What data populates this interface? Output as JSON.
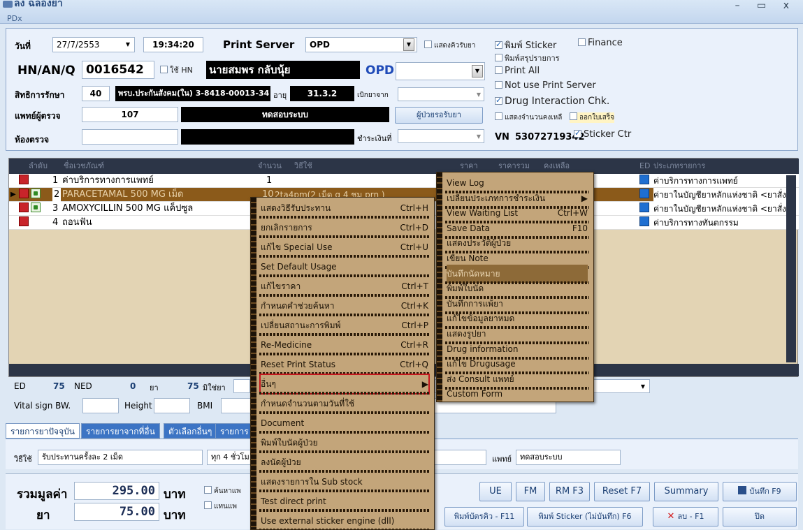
{
  "window": {
    "title": "ลง ฉลองยา",
    "subtitle": "PDx",
    "controls": "– ▭ x"
  },
  "header": {
    "date_label": "วันที่",
    "date_value": "27/7/2553",
    "time_value": "19:34:20",
    "print_server_label": "Print Server",
    "print_server_value": "OPD",
    "show_queue_label": "แสดงคิวรับยา",
    "print_sticker_label": "พิมพ์ Sticker",
    "finance_label": "Finance",
    "print_summary_label": "พิมพ์สรุปรายการ",
    "print_all_label": "Print All",
    "not_use_print_server_label": "Not use Print Server",
    "drug_interaction_label": "Drug Interaction Chk.",
    "show_remaining_label": "แสดงจำนวนคงเหลื",
    "issue_receipt_label": "ออกใบเสร็จ",
    "sticker_ctr_label": "Sticker Ctr",
    "hn_label": "HN/AN/Q",
    "hn_value": "0016542",
    "use_hn_label": "ใช้ HN",
    "patient_name": "นายสมพร  กลับนุ้ย",
    "dept_value": "OPD",
    "rights_label": "สิทธิการรักษา",
    "rights_code": "40",
    "rights_name": "พรบ.ประกันสังคม(ใน) 3-8418-00013-34",
    "age_label": "อายุ",
    "age_value": "31.3.2",
    "reimburse_label": "เบิกยาจาก",
    "doctor_label": "แพทย์ผู้ตรวจ",
    "doctor_code": "107",
    "doctor_name": "ทดสอบระบบ",
    "waiting_patients_button": "ผู้ป่วยรอรับยา",
    "room_label": "ห้องตรวจ",
    "payment_label": "ชำระเงินที่",
    "vn_label": "VN",
    "vn_value": "53072719342"
  },
  "grid": {
    "headers": [
      "ลำดับ",
      "ชื่อเวชภัณฑ์",
      "จำนวน",
      "วิธีใช้",
      "ราคา",
      "ราคารวม",
      "คงเหลือ",
      "ED",
      "ประเภทรายการ"
    ],
    "rows": [
      {
        "no": "1",
        "name": "ค่าบริการทางการแพทย์",
        "qty": "1",
        "usage": "",
        "category": "ค่าบริการทางการแพทย์"
      },
      {
        "no": "2",
        "name": "PARACETAMAL 500 MG เม็ด",
        "qty": "10",
        "usage": "2ta4pm(2 เม็ด q 4 ชม prn )",
        "category": "ค่ายาในบัญชียาหลักแห่งชาติ <ยาสั่งใ"
      },
      {
        "no": "3",
        "name": "AMOXYCILLIN 500 MG แค็ปซูล",
        "qty": "",
        "usage": "",
        "category": "ค่ายาในบัญชียาหลักแห่งชาติ <ยาสั่งใ"
      },
      {
        "no": "4",
        "name": "ถอนฟัน",
        "qty": "",
        "usage": "",
        "category": "ค่าบริการทางทันตกรรม"
      }
    ]
  },
  "context_menu": {
    "items": [
      {
        "label": "แสดงวิธีรับประทาน",
        "shortcut": "Ctrl+H"
      },
      {
        "label": "ยกเลิกรายการ",
        "shortcut": "Ctrl+D"
      },
      {
        "label": "แก้ไข Special Use",
        "shortcut": "Ctrl+U"
      },
      {
        "label": "Set Default Usage",
        "shortcut": ""
      },
      {
        "label": "แก้ไขราคา",
        "shortcut": "Ctrl+T"
      },
      {
        "label": "กำหนดคำช่วยค้นหา",
        "shortcut": "Ctrl+K"
      },
      {
        "label": "เปลี่ยนสถานะการพิมพ์",
        "shortcut": "Ctrl+P"
      },
      {
        "label": "Re-Medicine",
        "shortcut": "Ctrl+R"
      },
      {
        "label": "Reset Print Status",
        "shortcut": "Ctrl+Q"
      },
      {
        "label": "อื่นๆ",
        "shortcut": "▶"
      },
      {
        "label": "กำหนดจำนวนตามวันที่ใช้",
        "shortcut": ""
      },
      {
        "label": "Document",
        "shortcut": ""
      },
      {
        "label": "พิมพ์ใบนัดผู้ป่วย",
        "shortcut": ""
      },
      {
        "label": "ลงนัดผู้ป่วย",
        "shortcut": ""
      },
      {
        "label": "แสดงรายการใน Sub stock",
        "shortcut": ""
      },
      {
        "label": "Test direct print",
        "shortcut": ""
      },
      {
        "label": "Use external sticker engine (dll)",
        "shortcut": ""
      }
    ]
  },
  "sub_menu": {
    "items": [
      {
        "label": "View Log",
        "shortcut": ""
      },
      {
        "label": "เปลี่ยนประเภทการชำระเงิน",
        "shortcut": "▶"
      },
      {
        "label": "View Waiting List",
        "shortcut": "Ctrl+W"
      },
      {
        "label": "Save Data",
        "shortcut": "F10"
      },
      {
        "label": "แสดงประวัติผู้ป่วย",
        "shortcut": ""
      },
      {
        "label": "เขียน Note",
        "shortcut": ""
      },
      {
        "label": "บันทึกนัดหมาย",
        "shortcut": ""
      },
      {
        "label": "พิมพ์ใบนัด",
        "shortcut": ""
      },
      {
        "label": "บันทึกการแพ้ยา",
        "shortcut": ""
      },
      {
        "label": "แก้ไขข้อมูลยาหมด",
        "shortcut": ""
      },
      {
        "label": "แสดงรูปยา",
        "shortcut": ""
      },
      {
        "label": "Drug information",
        "shortcut": ""
      },
      {
        "label": "แก้ไข Drugusage",
        "shortcut": ""
      },
      {
        "label": "ส่ง Consult แพทย์",
        "shortcut": ""
      },
      {
        "label": "Custom Form",
        "shortcut": ""
      }
    ]
  },
  "stats": {
    "ed_label": "ED",
    "ed_value": "75",
    "ned_label": "NED",
    "ned_value": "0",
    "drug_label": "ยา",
    "drug_value": "75",
    "nondrug_label": "มิใช่ยา",
    "vital_label": "Vital sign  BW.",
    "height_label": "Height",
    "bmi_label": "BMI"
  },
  "tabs": [
    "รายการยาปัจจุบัน",
    "รายการยาจากที่อื่น",
    "ตัวเลือกอื่นๆ",
    "รายการ"
  ],
  "usage": {
    "label": "วิธีใช้",
    "value": "รับประทานครั้งละ 2 เม็ด",
    "freq": "ทุก 4 ชั่วโม",
    "doctor_label": "แพทย์",
    "doctor_value": "ทดสอบระบบ"
  },
  "totals": {
    "total_label": "รวมมูลค่า",
    "total_value": "295.00",
    "drug_label": "ยา",
    "drug_value": "75.00",
    "unit": "บาท",
    "search_label": "ค้นหาแพ",
    "replace_label": "แทนแพ"
  },
  "buttons": {
    "ue": "UE",
    "fm": "FM",
    "rm": "RM F3",
    "reset": "Reset F7",
    "summary": "Summary",
    "save": "บันทึก F9",
    "print_queue": "พิมพ์บัตรคิว - F11",
    "print_sticker": "พิมพ์ Sticker (ไม่บันทึก) F6",
    "delete": "ลบ - F1",
    "close": "ปิด"
  },
  "colors": {
    "menu_bg": "#c3a57a",
    "menu_highlight": "#8d6a38",
    "selected_row": "#8b5a1a",
    "accent": "#1f6fd1"
  }
}
